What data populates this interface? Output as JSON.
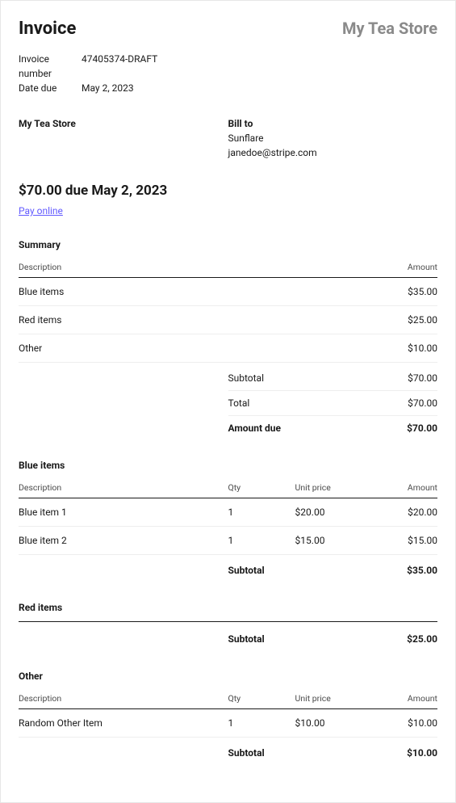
{
  "header": {
    "title": "Invoice",
    "store": "My Tea Store"
  },
  "meta": {
    "invoice_number_label": "Invoice number",
    "invoice_number": "47405374-DRAFT",
    "date_due_label": "Date due",
    "date_due": "May 2, 2023"
  },
  "from": {
    "label": "My Tea Store"
  },
  "billto": {
    "label": "Bill to",
    "name": "Sunflare",
    "email": "janedoe@stripe.com"
  },
  "due_line": "$70.00 due May 2, 2023",
  "pay_online": "Pay online",
  "summary": {
    "title": "Summary",
    "col_desc": "Description",
    "col_amount": "Amount",
    "rows": [
      {
        "desc": "Blue items",
        "amount": "$35.00"
      },
      {
        "desc": "Red items",
        "amount": "$25.00"
      },
      {
        "desc": "Other",
        "amount": "$10.00"
      }
    ],
    "totals": [
      {
        "label": "Subtotal",
        "value": "$70.00",
        "bold": false
      },
      {
        "label": "Total",
        "value": "$70.00",
        "bold": false
      },
      {
        "label": "Amount due",
        "value": "$70.00",
        "bold": true
      }
    ]
  },
  "groups": [
    {
      "title": "Blue items",
      "cols": {
        "desc": "Description",
        "qty": "Qty",
        "unit": "Unit price",
        "amount": "Amount"
      },
      "rows": [
        {
          "desc": "Blue item 1",
          "qty": "1",
          "unit": "$20.00",
          "amount": "$20.00"
        },
        {
          "desc": "Blue item 2",
          "qty": "1",
          "unit": "$15.00",
          "amount": "$15.00"
        }
      ],
      "subtotal_label": "Subtotal",
      "subtotal": "$35.00"
    },
    {
      "title": "Red items",
      "cols": null,
      "rows": [],
      "subtotal_label": "Subtotal",
      "subtotal": "$25.00"
    },
    {
      "title": "Other",
      "cols": {
        "desc": "Description",
        "qty": "Qty",
        "unit": "Unit price",
        "amount": "Amount"
      },
      "rows": [
        {
          "desc": "Random Other Item",
          "qty": "1",
          "unit": "$10.00",
          "amount": "$10.00"
        }
      ],
      "subtotal_label": "Subtotal",
      "subtotal": "$10.00"
    }
  ]
}
